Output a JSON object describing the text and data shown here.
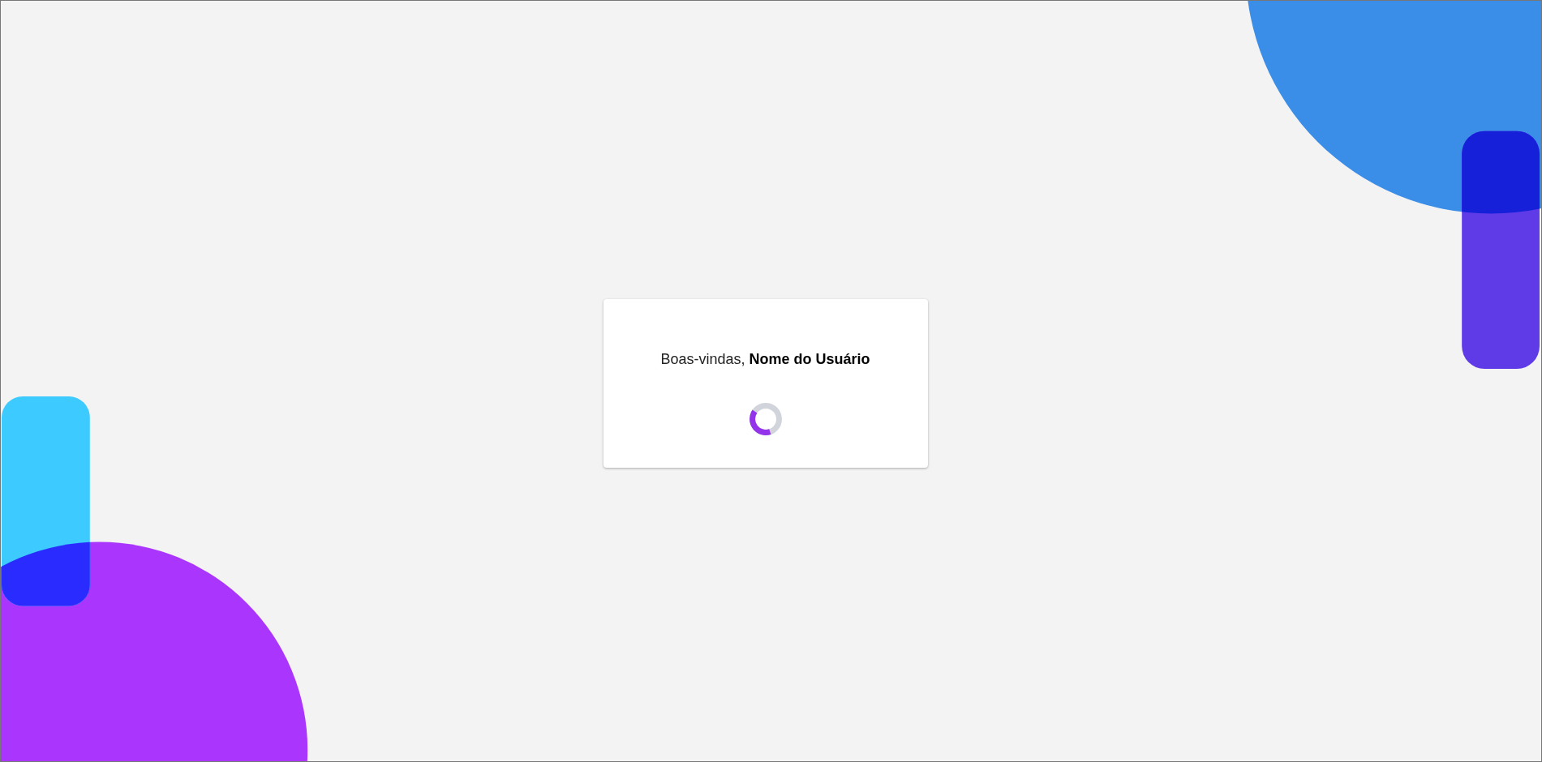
{
  "card": {
    "greeting": "Boas-vindas, **Nome do Usuário**"
  }
}
